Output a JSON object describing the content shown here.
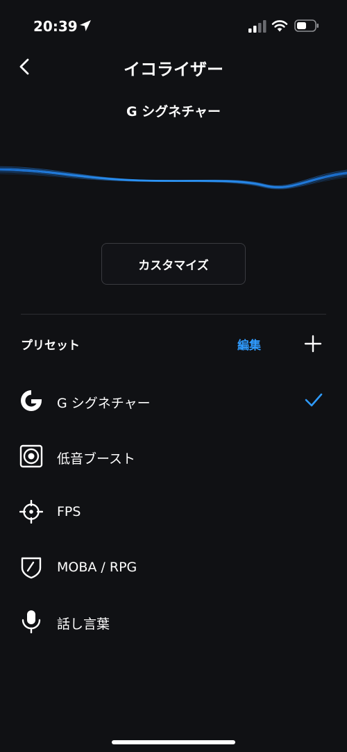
{
  "status_bar": {
    "time": "20:39",
    "location_icon": "location-arrow-icon",
    "signal_icon": "cellular-signal-icon",
    "wifi_icon": "wifi-icon",
    "battery_icon": "battery-icon"
  },
  "nav": {
    "back_icon": "chevron-left-icon",
    "title": "イコライザー"
  },
  "current_preset": "G シグネチャー",
  "customize_label": "カスタマイズ",
  "presets": {
    "heading": "プリセット",
    "edit_label": "編集",
    "add_icon": "plus-icon",
    "items": [
      {
        "label": "G シグネチャー",
        "icon": "logitech-g-icon",
        "selected": true
      },
      {
        "label": "低音ブースト",
        "icon": "speaker-icon",
        "selected": false
      },
      {
        "label": "FPS",
        "icon": "crosshair-icon",
        "selected": false
      },
      {
        "label": "MOBA / RPG",
        "icon": "shield-icon",
        "selected": false
      },
      {
        "label": "話し言葉",
        "icon": "microphone-icon",
        "selected": false
      }
    ]
  },
  "colors": {
    "background": "#101114",
    "accent": "#2f9bff",
    "text": "#ffffff",
    "divider": "#2c2d31"
  }
}
